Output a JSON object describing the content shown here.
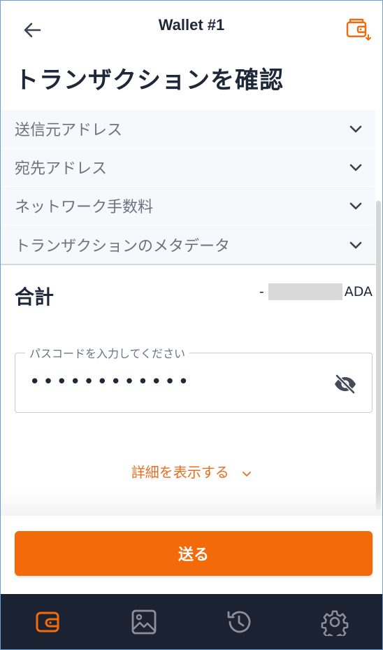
{
  "header": {
    "title": "Wallet #1",
    "back_icon": "arrow-left-icon",
    "switch_icon": "wallet-switch-icon"
  },
  "page_title": "トランザクションを確認",
  "accordion": [
    {
      "label": "送信元アドレス"
    },
    {
      "label": "宛先アドレス"
    },
    {
      "label": "ネットワーク手数料"
    },
    {
      "label": "トランザクションのメタデータ"
    }
  ],
  "total": {
    "label": "合計",
    "prefix": "-",
    "unit": "ADA"
  },
  "passcode": {
    "label": "パスコードを入力してください",
    "masked_value": "••••••••••••"
  },
  "details_link": "詳細を表示する",
  "send_button": "送る",
  "bottom_nav": [
    {
      "icon": "wallet-icon",
      "active": true
    },
    {
      "icon": "image-icon",
      "active": false
    },
    {
      "icon": "history-icon",
      "active": false
    },
    {
      "icon": "settings-icon",
      "active": false
    }
  ],
  "colors": {
    "accent": "#f26a0a",
    "link": "#ef6c1e",
    "nav_background": "#1b2232",
    "text_dark": "#1e2838",
    "text_muted": "#6b7380"
  }
}
